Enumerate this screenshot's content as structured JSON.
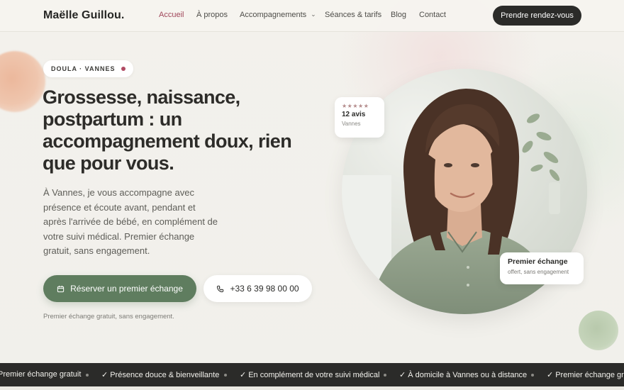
{
  "brand": "Maëlle Guillou.",
  "nav": {
    "items": [
      {
        "label": "Accueil",
        "active": true
      },
      {
        "label": "À propos"
      },
      {
        "label": "Accompagnements",
        "has_dropdown": true
      },
      {
        "label": "Séances & tarifs"
      },
      {
        "label": "Blog"
      },
      {
        "label": "Contact"
      }
    ],
    "cta": "Prendre rendez-vous"
  },
  "hero": {
    "badge": "DOULA · VANNES",
    "headline": "Grossesse, naissance, postpartum : un accompagnement doux, rien que pour vous.",
    "lead": "À Vannes, je vous accompagne avec présence et écoute avant, pendant et après l'arrivée de bébé, en complément de votre suivi médical. Premier échange gratuit, sans engagement.",
    "primary_button": "Réserver un premier échange",
    "secondary_button": "+33 6 39 98 00 00",
    "note": "Premier échange gratuit, sans engagement."
  },
  "review_card": {
    "stars": "★★★★★",
    "count": "12 avis",
    "location": "Vannes"
  },
  "offer_card": {
    "title": "Premier échange",
    "subtitle": "offert, sans engagement"
  },
  "ticker": {
    "items": [
      "Premier échange gratuit",
      "Présence douce & bienveillante",
      "En complément de votre suivi médical",
      "À domicile à Vannes ou à distance",
      "Premier échange gratuit"
    ],
    "check": "✓"
  },
  "colors": {
    "accent_active": "#a0465a",
    "primary_green": "#5f7d5f",
    "dark": "#2b2b29",
    "background": "#f3f1ec"
  },
  "icons": {
    "primary_button": "calendar-icon",
    "secondary_button": "phone-icon",
    "nav_dropdown": "chevron-down-icon"
  }
}
